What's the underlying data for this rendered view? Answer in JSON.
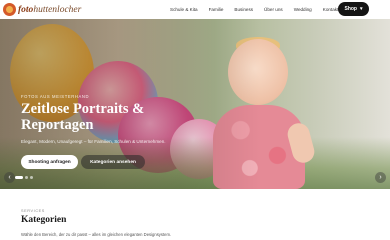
{
  "header": {
    "logo_prefix": "foto",
    "logo_name": "huttenlocher",
    "nav": [
      {
        "label": "Schule & Kita"
      },
      {
        "label": "Familie"
      },
      {
        "label": "Business"
      },
      {
        "label": "Über uns"
      },
      {
        "label": "Wedding"
      },
      {
        "label": "Kontakt"
      }
    ],
    "shop_label": "Shop",
    "shop_icon": "chevron-down-icon"
  },
  "hero": {
    "overline": "Fotos aus Meisterhand",
    "title": "Zeitlose Portraits & Reportagen",
    "subtitle": "Elegant, Modern, Unaufgeregt – für Familien, Schulen & Unternehmen.",
    "primary_button": "Shooting anfragen",
    "secondary_button": "Kategorien ansehen",
    "prev_arrow": "‹",
    "next_arrow": "›",
    "slides": 3,
    "active_slide": 1
  },
  "categories": {
    "overline": "Services",
    "title": "Kategorien",
    "description": "Wähle den Bereich, der zu dir passt – alles im gleichen eleganten Designsystem."
  }
}
